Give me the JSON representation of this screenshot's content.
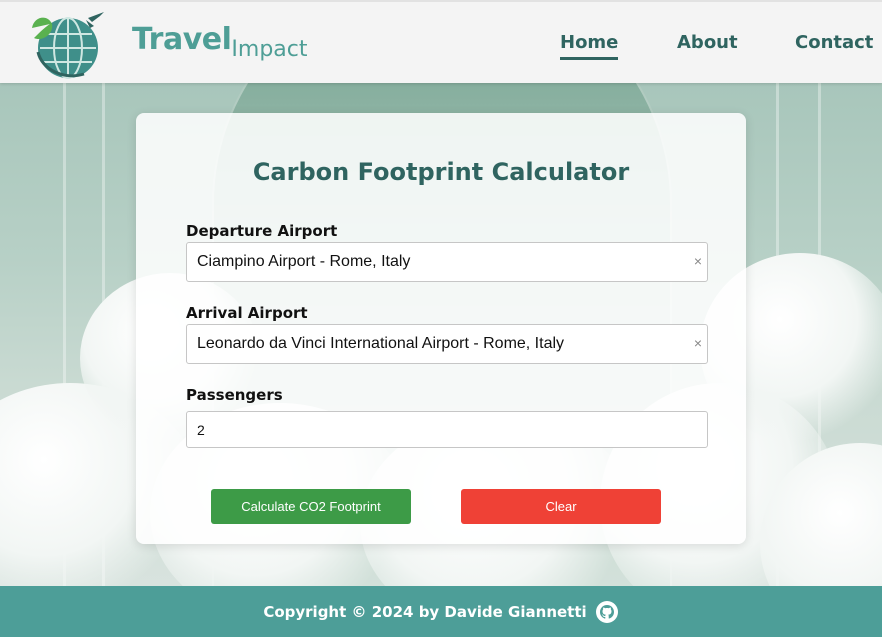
{
  "header": {
    "logo_word_main": "Travel",
    "logo_word_sub": "Impact",
    "nav": {
      "home": "Home",
      "about": "About",
      "contact": "Contact"
    },
    "active_nav": "home"
  },
  "form": {
    "title": "Carbon Footprint Calculator",
    "departure": {
      "label": "Departure Airport",
      "value": "Ciampino Airport - Rome, Italy",
      "clear_icon": "×"
    },
    "arrival": {
      "label": "Arrival Airport",
      "value": "Leonardo da Vinci International Airport - Rome, Italy",
      "clear_icon": "×"
    },
    "passengers": {
      "label": "Passengers",
      "value": "2"
    },
    "buttons": {
      "calculate": "Calculate CO2 Footprint",
      "clear": "Clear"
    }
  },
  "footer": {
    "copyright": "Copyright © 2024 by Davide Giannetti",
    "icon": "github-icon"
  },
  "colors": {
    "brand": "#4e9e96",
    "nav_text": "#2f6460",
    "calculate": "#3d9b47",
    "clear": "#ef4136",
    "footer_bg": "#4d9e98"
  }
}
